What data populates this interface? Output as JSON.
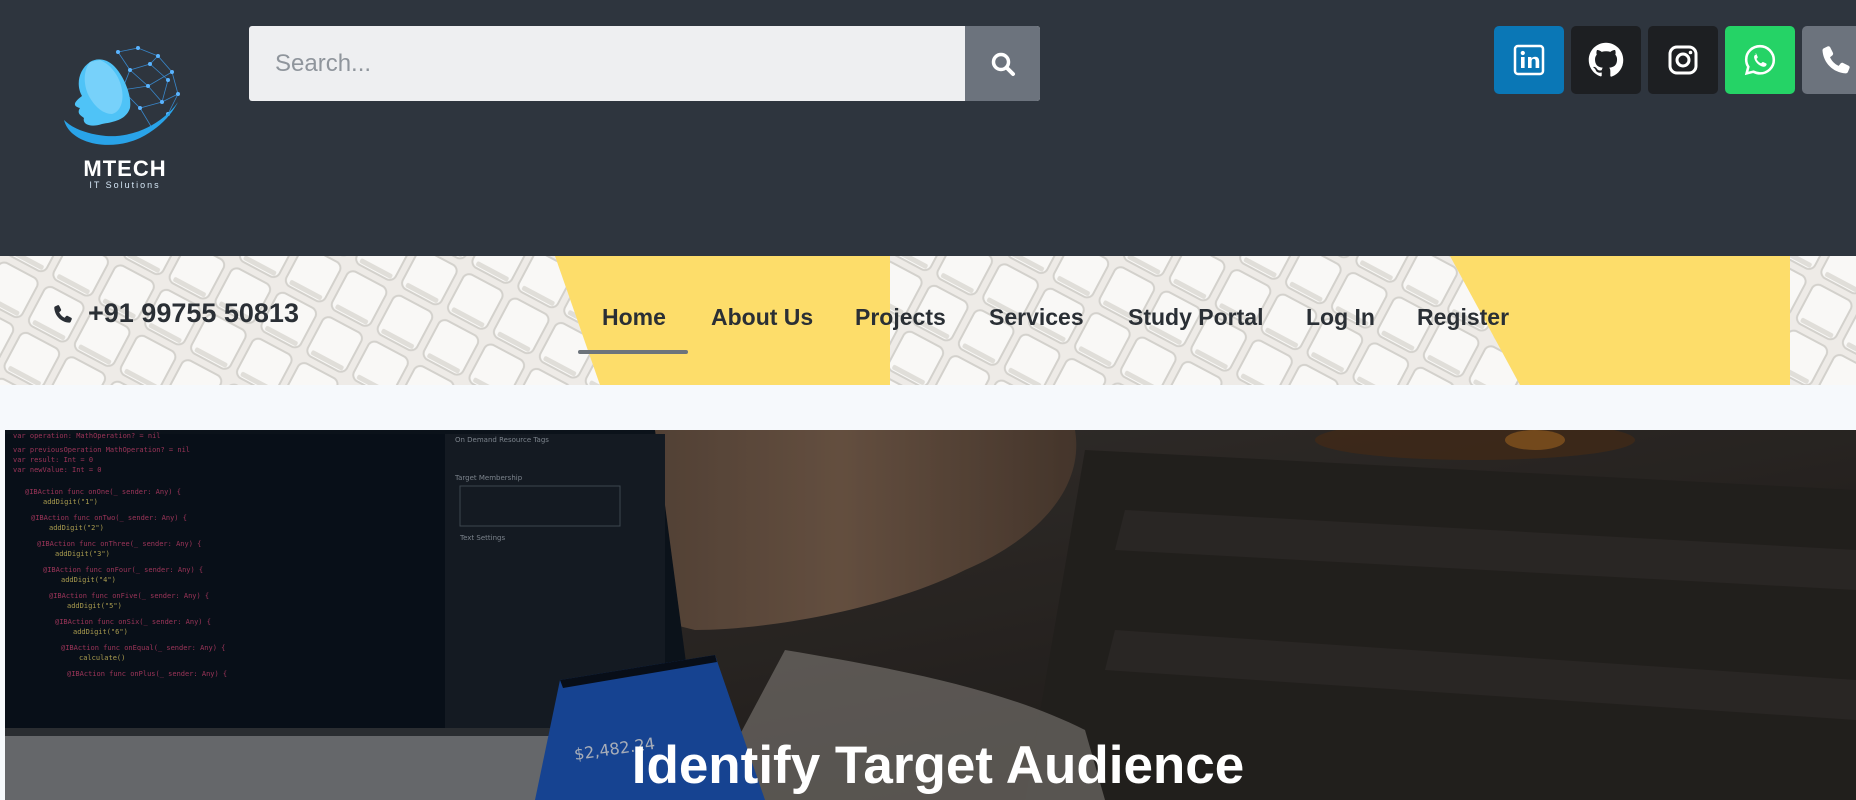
{
  "header": {
    "logo": {
      "name": "MTECH",
      "tagline": "IT Solutions"
    },
    "search": {
      "placeholder": "Search..."
    },
    "social": [
      {
        "name": "LinkedIn",
        "icon": "linkedin-icon",
        "color": "#0a77b6"
      },
      {
        "name": "GitHub",
        "icon": "github-icon",
        "color": "#1d1f22"
      },
      {
        "name": "Instagram",
        "icon": "instagram-icon",
        "color": "#1d1f22"
      },
      {
        "name": "WhatsApp",
        "icon": "whatsapp-icon",
        "color": "#25d366"
      },
      {
        "name": "Phone",
        "icon": "phone-icon",
        "color": "#6c737d"
      }
    ]
  },
  "contact": {
    "phone": "+91 99755 50813"
  },
  "nav": {
    "items": [
      {
        "label": "Home",
        "active": true
      },
      {
        "label": "About Us"
      },
      {
        "label": "Projects"
      },
      {
        "label": "Services"
      },
      {
        "label": "Study Portal"
      },
      {
        "label": "Log In"
      },
      {
        "label": "Register"
      }
    ]
  },
  "hero": {
    "title": "Identify Target Audience"
  },
  "colors": {
    "header_bg": "#2e353e",
    "nav_accent": "#6d747b",
    "keyboard_yellow": "#fdd440"
  }
}
